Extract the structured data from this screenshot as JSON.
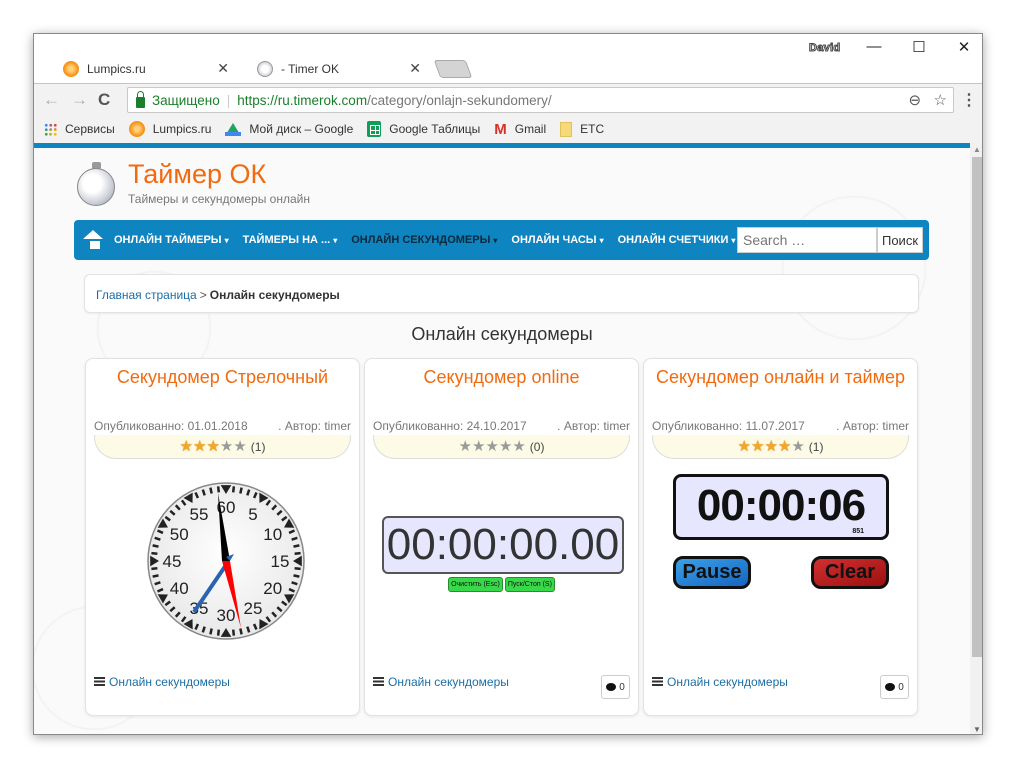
{
  "browser": {
    "tabs": [
      {
        "title": "Lumpics.ru",
        "favicon": "orange-icon",
        "active": false
      },
      {
        "title": "- Timer OK",
        "favicon": "stopwatch-icon",
        "active": true
      }
    ],
    "profile_name": "David",
    "window_controls": {
      "minimize": "—",
      "maximize": "☐",
      "close": "✕"
    },
    "nav": {
      "back": "←",
      "forward": "→",
      "reload": "C"
    },
    "address": {
      "security_label": "Защищено",
      "scheme": "https://",
      "host": "ru.timerok.com",
      "path": "/category/onlajn-sekundomery/"
    },
    "omnibox_icons": {
      "zoom": "⊖",
      "star": "☆"
    },
    "menu": "⋮",
    "bookmarks": [
      {
        "label": "Сервисы",
        "icon": "apps-icon"
      },
      {
        "label": "Lumpics.ru",
        "icon": "orange-icon"
      },
      {
        "label": "Мой диск – Google",
        "icon": "drive-icon"
      },
      {
        "label": "Google Таблицы",
        "icon": "sheets-icon"
      },
      {
        "label": "Gmail",
        "icon": "gmail-icon"
      },
      {
        "label": "ETC",
        "icon": "folder-icon"
      }
    ]
  },
  "site": {
    "title": "Таймер ОК",
    "subtitle": "Таймеры и секундомеры онлайн",
    "nav": [
      {
        "label": "ОНЛАЙН ТАЙМЕРЫ",
        "active": false
      },
      {
        "label": "ТАЙМЕРЫ НА ...",
        "active": false
      },
      {
        "label": "ОНЛАЙН СЕКУНДОМЕРЫ",
        "active": true
      },
      {
        "label": "ОНЛАЙН ЧАСЫ",
        "active": false
      },
      {
        "label": "ОНЛАЙН СЧЕТЧИКИ",
        "active": false
      }
    ],
    "caret": "▾",
    "search": {
      "placeholder": "Search …",
      "button": "Поиск"
    },
    "breadcrumb": {
      "home": "Главная страница",
      "separator": ">",
      "current": "Онлайн секундомеры"
    },
    "heading": "Онлайн секундомеры",
    "accent_color": "#0e84c0",
    "title_color": "#f26a10"
  },
  "cards": [
    {
      "title": "Секундомер Стрелочный",
      "published": "Опубликованно: 01.01.2018",
      "author": ". Автор: timer",
      "rating": 3,
      "rating_max": 5,
      "rating_count": "(1)",
      "category_link": "Онлайн секундомеры",
      "comments": null,
      "widget": {
        "type": "analog",
        "dial_labels": [
          "60",
          "5",
          "10",
          "15",
          "20",
          "25",
          "30",
          "35",
          "40",
          "45",
          "50",
          "55"
        ]
      }
    },
    {
      "title": "Секундомер online",
      "published": "Опубликованно: 24.10.2017",
      "author": ". Автор: timer",
      "rating": 0,
      "rating_max": 5,
      "rating_count": "(0)",
      "category_link": "Онлайн секундомеры",
      "comments": "0",
      "widget": {
        "type": "digital",
        "display": "00:00:00.00",
        "buttons": [
          "Очистить (Esc)",
          "Пуск/Стоп (S)"
        ]
      }
    },
    {
      "title": "Секундомер онлайн и таймер",
      "published": "Опубликованно: 11.07.2017",
      "author": ". Автор: timer",
      "rating": 4,
      "rating_max": 5,
      "rating_count": "(1)",
      "category_link": "Онлайн секундомеры",
      "comments": "0",
      "widget": {
        "type": "timer",
        "display": "00:00:06",
        "milliseconds": "851",
        "buttons": [
          "Pause",
          "Clear"
        ]
      }
    }
  ],
  "scrollbar": {
    "up": "▲",
    "down": "▼"
  }
}
